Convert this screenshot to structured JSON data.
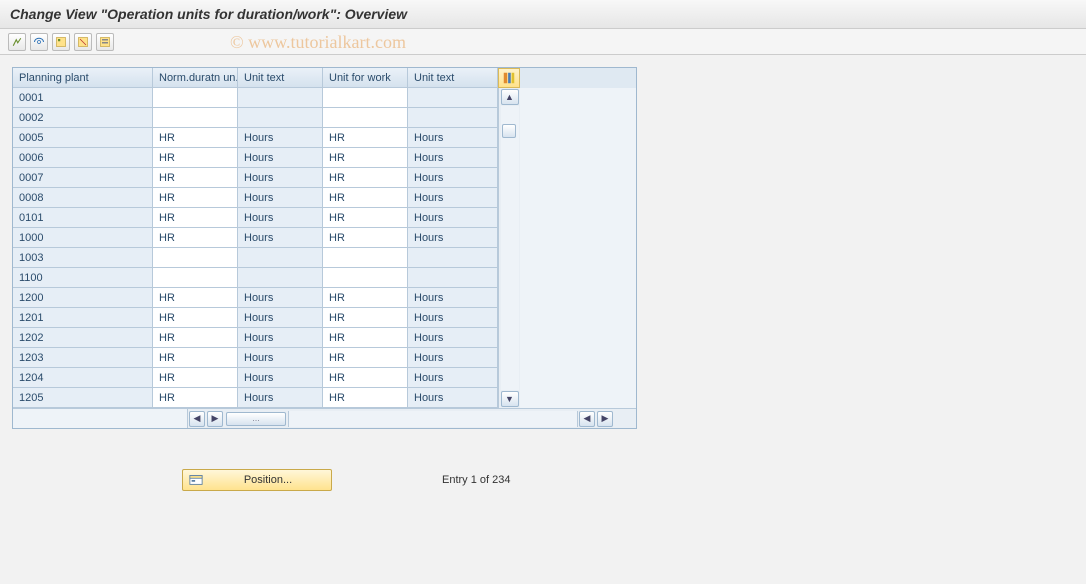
{
  "title": "Change View \"Operation units for duration/work\": Overview",
  "watermark": "© www.tutorialkart.com",
  "toolbar": {
    "btn1": "other-view",
    "btn2": "change",
    "btn3": "select-all",
    "btn4": "deselect-all",
    "btn5": "table-settings"
  },
  "columns": {
    "c0": "Planning plant",
    "c1": "Norm.duratn un.",
    "c2": "Unit text",
    "c3": "Unit for work",
    "c4": "Unit text"
  },
  "rows": [
    {
      "plant": "0001",
      "dun": "",
      "ut1": "",
      "ufw": "",
      "ut2": ""
    },
    {
      "plant": "0002",
      "dun": "",
      "ut1": "",
      "ufw": "",
      "ut2": ""
    },
    {
      "plant": "0005",
      "dun": "HR",
      "ut1": "Hours",
      "ufw": "HR",
      "ut2": "Hours"
    },
    {
      "plant": "0006",
      "dun": "HR",
      "ut1": "Hours",
      "ufw": "HR",
      "ut2": "Hours"
    },
    {
      "plant": "0007",
      "dun": "HR",
      "ut1": "Hours",
      "ufw": "HR",
      "ut2": "Hours"
    },
    {
      "plant": "0008",
      "dun": "HR",
      "ut1": "Hours",
      "ufw": "HR",
      "ut2": "Hours"
    },
    {
      "plant": "0101",
      "dun": "HR",
      "ut1": "Hours",
      "ufw": "HR",
      "ut2": "Hours"
    },
    {
      "plant": "1000",
      "dun": "HR",
      "ut1": "Hours",
      "ufw": "HR",
      "ut2": "Hours"
    },
    {
      "plant": "1003",
      "dun": "",
      "ut1": "",
      "ufw": "",
      "ut2": ""
    },
    {
      "plant": "1100",
      "dun": "",
      "ut1": "",
      "ufw": "",
      "ut2": ""
    },
    {
      "plant": "1200",
      "dun": "HR",
      "ut1": "Hours",
      "ufw": "HR",
      "ut2": "Hours"
    },
    {
      "plant": "1201",
      "dun": "HR",
      "ut1": "Hours",
      "ufw": "HR",
      "ut2": "Hours"
    },
    {
      "plant": "1202",
      "dun": "HR",
      "ut1": "Hours",
      "ufw": "HR",
      "ut2": "Hours"
    },
    {
      "plant": "1203",
      "dun": "HR",
      "ut1": "Hours",
      "ufw": "HR",
      "ut2": "Hours"
    },
    {
      "plant": "1204",
      "dun": "HR",
      "ut1": "Hours",
      "ufw": "HR",
      "ut2": "Hours"
    },
    {
      "plant": "1205",
      "dun": "HR",
      "ut1": "Hours",
      "ufw": "HR",
      "ut2": "Hours"
    }
  ],
  "footer": {
    "position_label": "Position...",
    "status": "Entry 1 of 234"
  },
  "hscroll_thumb": "..."
}
